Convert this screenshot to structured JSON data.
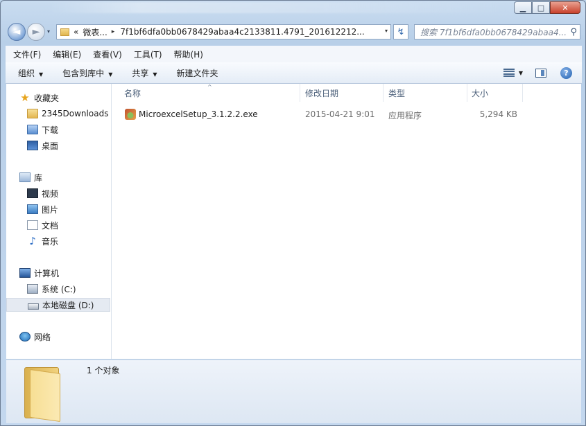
{
  "window": {
    "controls": {
      "minimize": "▁",
      "maximize": "□",
      "close": "✕"
    }
  },
  "navigation": {
    "back_glyph": "◄",
    "forward_glyph": "►",
    "address_parts": [
      "«",
      "微表...",
      "▸",
      "7f1bf6dfa0bb0678429abaa4c2133811.4791_201612212..."
    ],
    "dropdown_glyph": "▾",
    "refresh_glyph": "↯",
    "search_placeholder": "搜索 7f1bf6dfa0bb0678429abaa4...",
    "search_icon": "⚲"
  },
  "menu": [
    "文件(F)",
    "编辑(E)",
    "查看(V)",
    "工具(T)",
    "帮助(H)"
  ],
  "toolbar": {
    "organize": "组织",
    "include_in_library": "包含到库中",
    "share": "共享",
    "new_folder": "新建文件夹",
    "dropdown_glyph": "▼",
    "help_glyph": "?"
  },
  "sidebar": {
    "favorites": {
      "label": "收藏夹",
      "items": [
        "2345Downloads",
        "下载",
        "桌面"
      ]
    },
    "libraries": {
      "label": "库",
      "items": [
        "视频",
        "图片",
        "文档",
        "音乐"
      ]
    },
    "computer": {
      "label": "计算机",
      "items": [
        "系统 (C:)",
        "本地磁盘 (D:)"
      ]
    },
    "network": {
      "label": "网络"
    },
    "star_glyph": "★",
    "music_glyph": "♪"
  },
  "columns": {
    "name": "名称",
    "modified": "修改日期",
    "type": "类型",
    "size": "大小",
    "sort_glyph": "^"
  },
  "files": [
    {
      "name": "MicroexcelSetup_3.1.2.2.exe",
      "modified": "2015-04-21 9:01",
      "type": "应用程序",
      "size": "5,294 KB"
    }
  ],
  "details": {
    "count": "1 个对象"
  }
}
